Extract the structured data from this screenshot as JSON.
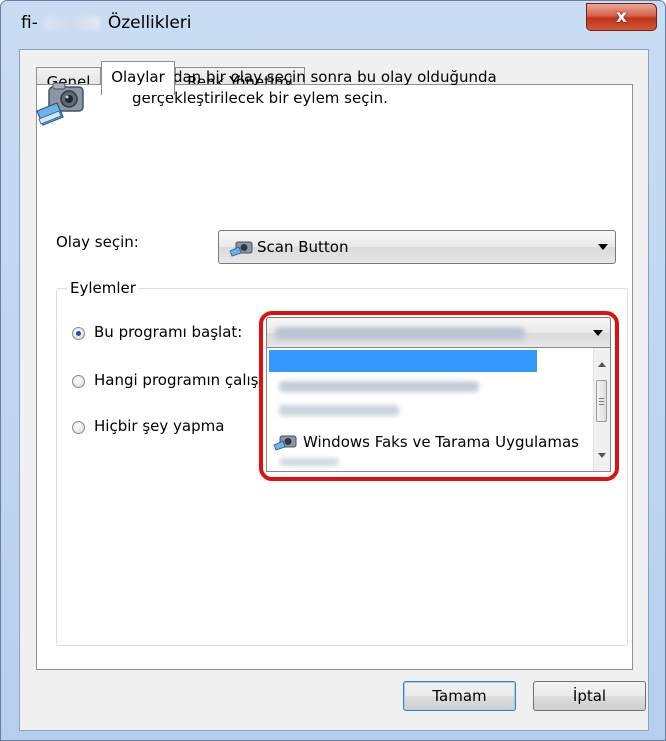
{
  "window": {
    "title_prefix": "fi-",
    "title_suffix": "Özellikleri",
    "close_label": "x"
  },
  "tabs": [
    {
      "label": "Genel"
    },
    {
      "label": "Olaylar"
    },
    {
      "label": "Renk Yönetimi"
    }
  ],
  "active_tab": "Olaylar",
  "events_tab": {
    "description_line1": "Aşağıdan bir olay seçin sonra bu olay olduğunda",
    "description_line2": "gerçekleştirilecek bir eylem seçin.",
    "event_label": "Olay seçin:",
    "event_value": "Scan Button",
    "actions_group_label": "Eylemler",
    "radio_start_program": "Bu programı başlat:",
    "radio_ask_program": "Hangi programın çalış",
    "radio_do_nothing": "Hiçbir şey yapma",
    "program_dropdown": {
      "visible_option": "Windows Faks ve Tarama Uygulamas"
    }
  },
  "buttons": {
    "ok": "Tamam",
    "cancel": "İptal"
  },
  "colors": {
    "highlight_border": "#e01010",
    "selection": "#3399ff",
    "window_frame": "#b7cfee"
  }
}
